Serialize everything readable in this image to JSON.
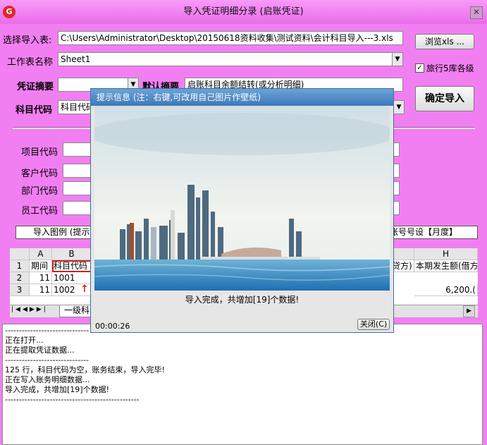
{
  "window": {
    "title": "导入凭证明细分录 (启账凭证)",
    "close_glyph": "✕"
  },
  "form": {
    "import_table_label": "选择导入表:",
    "import_table_path": "C:\\Users\\Administrator\\Desktop\\20150618资料收集\\测试资料\\会计科目导入---3.xls",
    "browse_label": "浏览xls ...",
    "sheet_label": "工作表名称",
    "sheet_value": "Sheet1",
    "option_checkbox_label": "旅行5库各级",
    "option_checked": true,
    "voucher_summary_label": "凭证摘要",
    "voucher_summary_value": "",
    "default_summary_label": "默认摘要",
    "default_summary_value": "启账科目余额结转(或分析明细)",
    "confirm_label": "确定导入",
    "account_code_label": "科目代码",
    "account_code_value": "科目代码",
    "project_code_label": "项目代码",
    "customer_code_label": "客户代码",
    "department_code_label": "部门代码",
    "employee_code_label": "员工代码"
  },
  "legend": {
    "left_text": "导入图例 (提示",
    "right_text": "账号号设【月度】"
  },
  "spreadsheet": {
    "col_headers": [
      "",
      "A",
      "B",
      "H"
    ],
    "row_numbers": [
      "1",
      "2",
      "3"
    ],
    "row1": {
      "a": "期间",
      "b": "科目代码",
      "g_partial": "贷方)",
      "h": "本期发生额(借方"
    },
    "row2": {
      "a": "11",
      "b": "1001"
    },
    "row3": {
      "a": "11",
      "b": "1002",
      "h": "6,200.("
    },
    "sheet_tab": "一级科"
  },
  "log": {
    "lines": [
      "------------------------------",
      "正在打开...",
      "正在提取凭证数据...",
      "------------------------------",
      "125 行，科目代码为空，账务结束，导入完毕!",
      "正在写入账务明细数据...",
      "导入完成，共增加[19]个数据!",
      "------------------------------------------------"
    ]
  },
  "dialog": {
    "title": "提示信息   (注：右键,可改用自己图片作壁纸)",
    "message": "导入完成，共增加[19]个数据!",
    "timer": "00:00:26",
    "close_label": "关闭(C)"
  },
  "colors": {
    "window_bg": "#f27ff2",
    "dialog_title": "#4a86c4"
  }
}
